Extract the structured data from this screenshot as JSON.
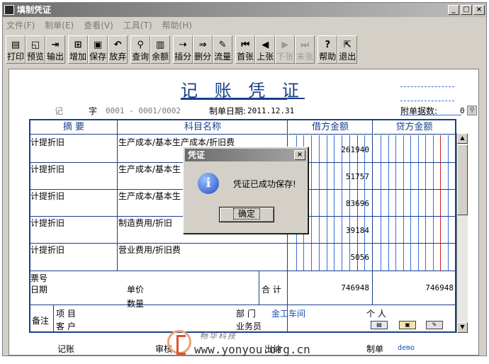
{
  "window": {
    "title": "填制凭证",
    "min": "_",
    "max": "□",
    "close": "×"
  },
  "menu": [
    "文件(F)",
    "制单(E)",
    "查看(V)",
    "工具(T)",
    "帮助(H)"
  ],
  "toolbar": [
    {
      "label": "打印",
      "icon": "▤",
      "name": "print",
      "enabled": true
    },
    {
      "label": "预览",
      "icon": "◱",
      "name": "preview",
      "enabled": true
    },
    {
      "label": "输出",
      "icon": "⇥",
      "name": "export",
      "enabled": true
    },
    {
      "label": "增加",
      "icon": "⊞",
      "name": "add",
      "enabled": true
    },
    {
      "label": "保存",
      "icon": "▣",
      "name": "save",
      "enabled": true
    },
    {
      "label": "放弃",
      "icon": "↶",
      "name": "discard",
      "enabled": true
    },
    {
      "label": "查询",
      "icon": "⚲",
      "name": "query",
      "enabled": true
    },
    {
      "label": "余额",
      "icon": "▥",
      "name": "balance",
      "enabled": true
    },
    {
      "label": "插分",
      "icon": "⇢",
      "name": "insert-entry",
      "enabled": true
    },
    {
      "label": "删分",
      "icon": "⇒",
      "name": "delete-entry",
      "enabled": true
    },
    {
      "label": "流量",
      "icon": "✎",
      "name": "cashflow",
      "enabled": true
    },
    {
      "label": "首张",
      "icon": "⏮",
      "name": "first",
      "enabled": true
    },
    {
      "label": "上张",
      "icon": "◀",
      "name": "prev",
      "enabled": true
    },
    {
      "label": "下张",
      "icon": "▶",
      "name": "next",
      "enabled": false
    },
    {
      "label": "末张",
      "icon": "⏭",
      "name": "last",
      "enabled": false
    },
    {
      "label": "帮助",
      "icon": "?",
      "name": "help",
      "enabled": true
    },
    {
      "label": "退出",
      "icon": "⇱",
      "name": "exit",
      "enabled": true
    }
  ],
  "voucher": {
    "title": "记 账 凭 证",
    "type_label": "记",
    "zi_label": "字",
    "number": "0001 - 0001/0002",
    "date_label": "制单日期:",
    "date": "2011.12.31",
    "attach_label": "附单据数:",
    "attach_value": "0",
    "headers": {
      "summary": "摘 要",
      "account": "科目名称",
      "debit": "借方金额",
      "credit": "贷方金额"
    },
    "rows": [
      {
        "summary": "计提折旧",
        "account": "生产成本/基本生产成本/折旧费",
        "debit": "261940",
        "credit": ""
      },
      {
        "summary": "计提折旧",
        "account": "生产成本/基本生",
        "debit": "51757",
        "credit": ""
      },
      {
        "summary": "计提折旧",
        "account": "生产成本/基本生",
        "debit": "83696",
        "credit": ""
      },
      {
        "summary": "计提折旧",
        "account": "制造费用/折旧",
        "debit": "39184",
        "credit": ""
      },
      {
        "summary": "计提折旧",
        "account": "营业费用/折旧费",
        "debit": "5056",
        "credit": ""
      }
    ],
    "footer": {
      "ticket_label": "票号",
      "date_label": "日期",
      "price_label": "单价",
      "qty_label": "数量",
      "total_label": "合 计",
      "debit_total": "746948",
      "credit_total": "746948",
      "remark_label": "备注",
      "project_label": "项 目",
      "customer_label": "客 户",
      "dept_label": "部 门",
      "dept_value": "金工车间",
      "person_label": "个 人",
      "salesman_label": "业务员"
    },
    "bottom": {
      "booked_label": "记账",
      "audit_label": "审核",
      "cashier_label": "出纳",
      "maker_label": "制单",
      "maker_value": "demo"
    }
  },
  "dialog": {
    "title": "凭证",
    "message": "凭证已成功保存!",
    "ok": "确定",
    "close": "×",
    "icon": "i"
  },
  "watermark": {
    "cn": "畅华科技",
    "url": "www.yonyou.org.cn"
  },
  "colors": {
    "grid": "#1a3f8a",
    "money_line": "#3a6fd6",
    "money_red": "#d02020"
  }
}
